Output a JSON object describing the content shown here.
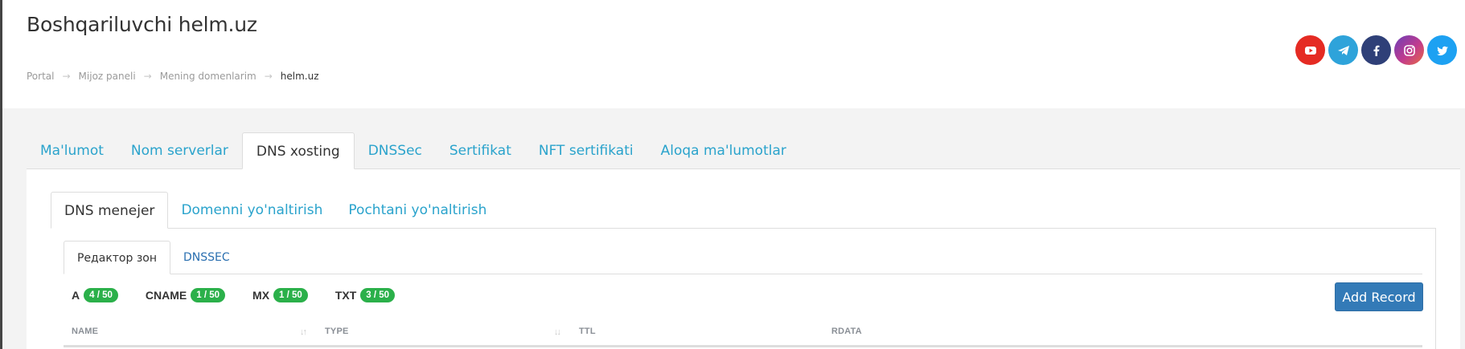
{
  "header": {
    "title": "Boshqariluvchi helm.uz",
    "breadcrumb": [
      "Portal",
      "Mijoz paneli",
      "Mening domenlarim",
      "helm.uz"
    ]
  },
  "social": {
    "icons": [
      "youtube-icon",
      "telegram-icon",
      "facebook-icon",
      "instagram-icon",
      "twitter-icon"
    ]
  },
  "outer_tabs": [
    "Ma'lumot",
    "Nom serverlar",
    "DNS xosting",
    "DNSSec",
    "Sertifikat",
    "NFT sertifikati",
    "Aloqa ma'lumotlar"
  ],
  "outer_tabs_active": "DNS xosting",
  "inner_tabs": [
    "DNS menejer",
    "Domenni yo'naltirish",
    "Pochtani yo'naltirish"
  ],
  "inner_tabs_active": "DNS menejer",
  "sub_tabs": [
    "Редактор зон",
    "DNSSEC"
  ],
  "sub_tabs_active": "Редактор зон",
  "record_counts": [
    {
      "type": "A",
      "count": "4 / 50"
    },
    {
      "type": "CNAME",
      "count": "1 / 50"
    },
    {
      "type": "MX",
      "count": "1 / 50"
    },
    {
      "type": "TXT",
      "count": "3 / 50"
    }
  ],
  "add_record_label": "Add Record",
  "table": {
    "columns": [
      "NAME",
      "TYPE",
      "TTL",
      "RDATA"
    ]
  },
  "colors": {
    "link": "#2aa3cc",
    "badge": "#2bb04a",
    "primary_button": "#337ab7"
  }
}
